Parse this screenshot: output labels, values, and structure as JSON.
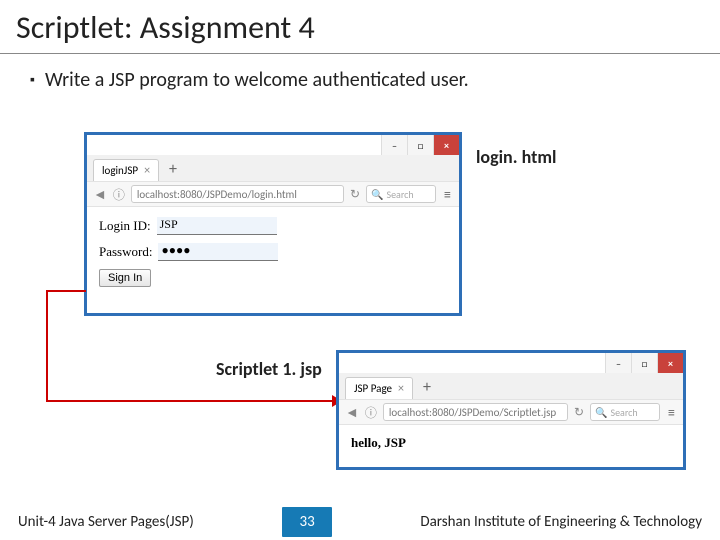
{
  "slide": {
    "title": "Scriptlet: Assignment 4",
    "bullet": "Write a JSP program to welcome authenticated user."
  },
  "label1": "login. html",
  "label2": "Scriptlet 1. jsp",
  "browser1": {
    "tab": "loginJSP",
    "plus": "+",
    "url": "localhost:8080/JSPDemo/login.html",
    "search": "Search",
    "form": {
      "loginLabel": "Login ID:",
      "loginValue": "JSP",
      "passLabel": "Password:",
      "passValue": "●●●●",
      "button": "Sign In"
    }
  },
  "browser2": {
    "tab": "JSP Page",
    "plus": "+",
    "url": "localhost:8080/JSPDemo/Scriptlet.jsp",
    "search": "Search",
    "output": "hello, JSP"
  },
  "win": {
    "min": "–",
    "max": "□",
    "close": "×"
  },
  "footer": {
    "left": "Unit-4 Java Server Pages(JSP)",
    "page": "33",
    "right": "Darshan Institute of Engineering & Technology"
  }
}
